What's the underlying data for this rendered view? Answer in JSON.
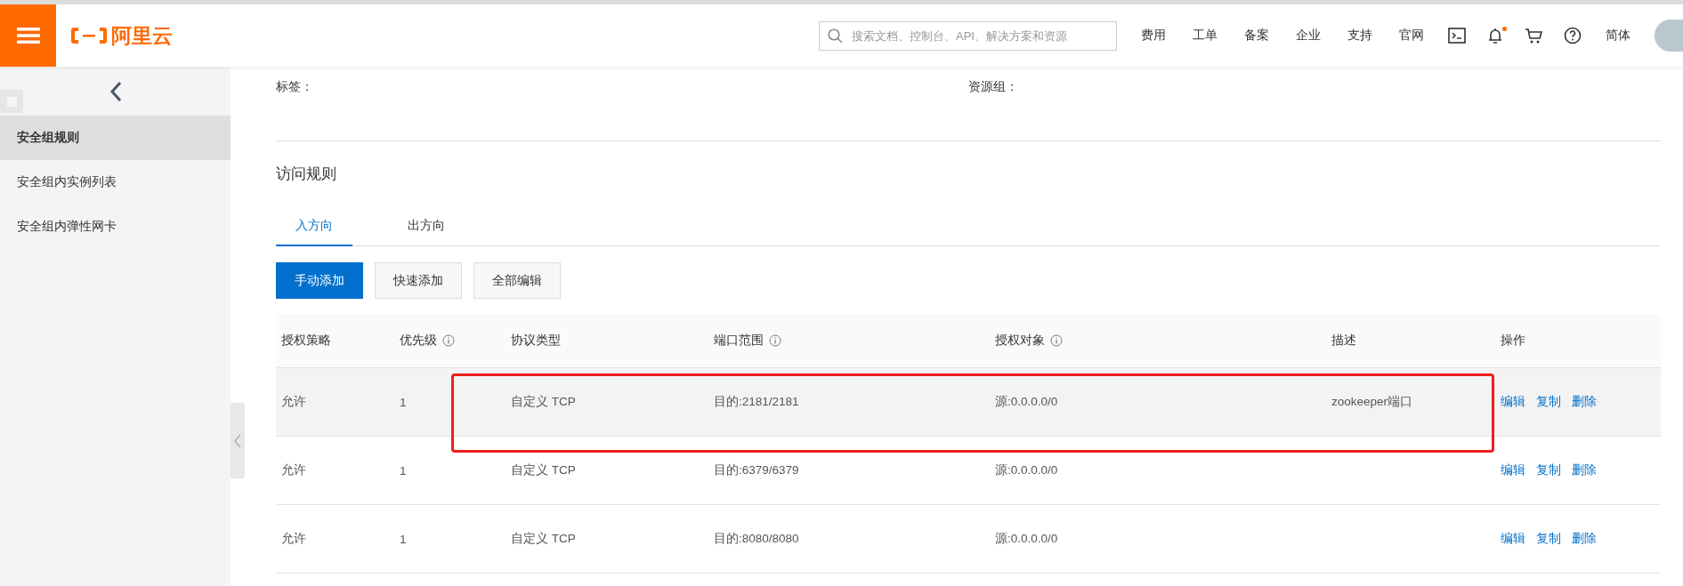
{
  "header": {
    "logo_text": "阿里云",
    "search": {
      "placeholder": "搜索文档、控制台、API、解决方案和资源"
    },
    "nav_links": [
      "费用",
      "工单",
      "备案",
      "企业",
      "支持",
      "官网"
    ],
    "notification_dot": true,
    "language": "简体"
  },
  "sidebar": {
    "items": [
      {
        "label": "安全组规则",
        "selected": true
      },
      {
        "label": "安全组内实例列表",
        "selected": false
      },
      {
        "label": "安全组内弹性网卡",
        "selected": false
      }
    ]
  },
  "info_fields": [
    {
      "label": "标签："
    },
    {
      "label": "资源组："
    }
  ],
  "section_title": "访问规则",
  "tabs": [
    {
      "label": "入方向",
      "selected": true
    },
    {
      "label": "出方向",
      "selected": false
    }
  ],
  "buttons": [
    {
      "label": "手动添加",
      "kind": "primary"
    },
    {
      "label": "快速添加",
      "kind": "default"
    },
    {
      "label": "全部编辑",
      "kind": "default"
    }
  ],
  "table": {
    "columns": [
      {
        "label": "授权策略",
        "info": false
      },
      {
        "label": "优先级",
        "info": true
      },
      {
        "label": "协议类型",
        "info": false
      },
      {
        "label": "端口范围",
        "info": true
      },
      {
        "label": "授权对象",
        "info": true
      },
      {
        "label": "描述",
        "info": false
      },
      {
        "label": "操作",
        "info": false
      }
    ],
    "rows": [
      {
        "cells": [
          "允许",
          "1",
          "自定义 TCP",
          "目的:2181/2181",
          "源:0.0.0.0/0",
          "zookeeper端口"
        ],
        "actions": [
          "编辑",
          "复制",
          "删除"
        ],
        "hovered": true,
        "annotated": true
      },
      {
        "cells": [
          "允许",
          "1",
          "自定义 TCP",
          "目的:6379/6379",
          "源:0.0.0.0/0",
          ""
        ],
        "actions": [
          "编辑",
          "复制",
          "删除"
        ],
        "hovered": false,
        "annotated": false
      },
      {
        "cells": [
          "允许",
          "1",
          "自定义 TCP",
          "目的:8080/8080",
          "源:0.0.0.0/0",
          ""
        ],
        "actions": [
          "编辑",
          "复制",
          "删除"
        ],
        "hovered": false,
        "annotated": false
      }
    ]
  }
}
